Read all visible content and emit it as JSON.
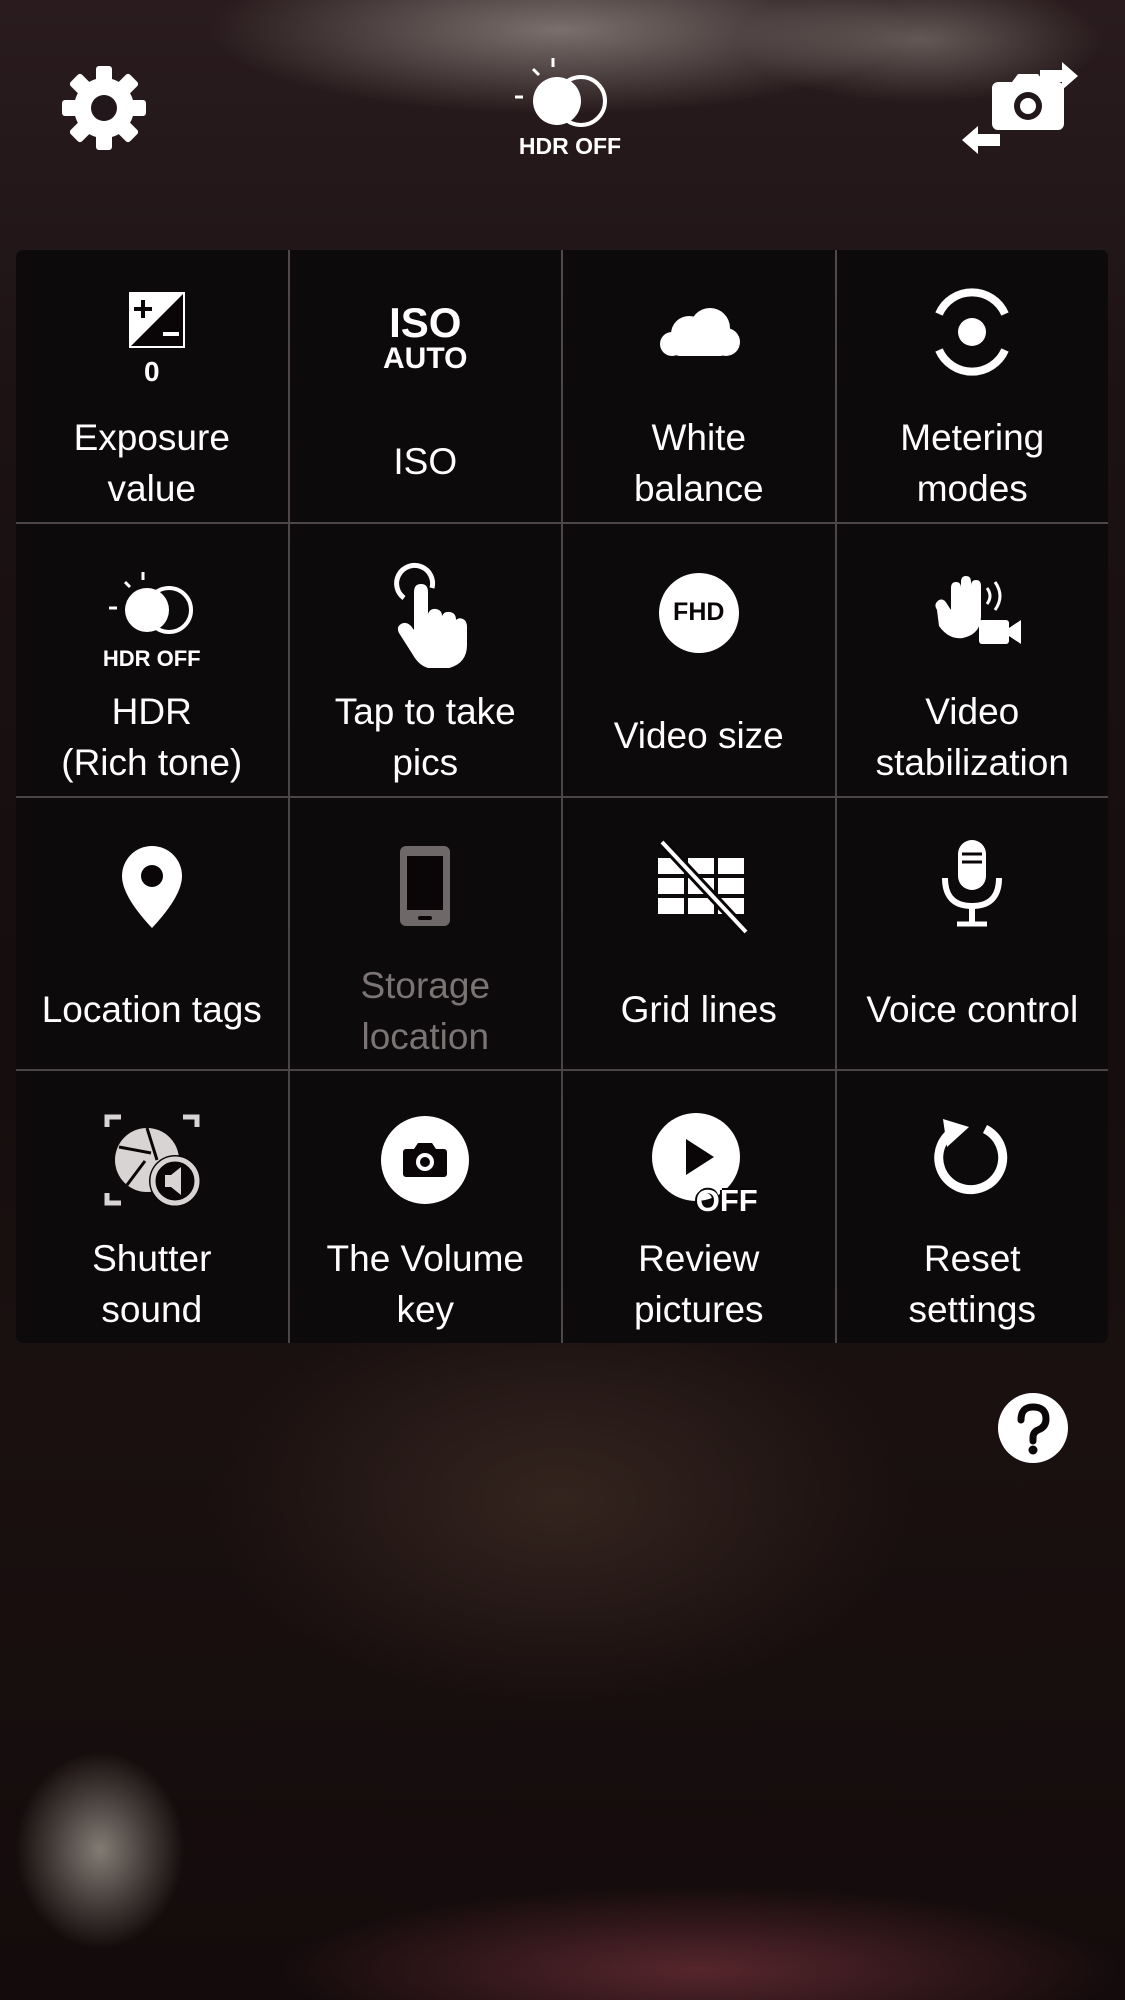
{
  "topbar": {
    "settings_icon": "gear-icon",
    "hdr_badge": "HDR OFF",
    "switch_icon": "switch-camera-icon"
  },
  "settings": [
    {
      "label": "Exposure\nvalue",
      "icon": "exposure-icon",
      "value": "0"
    },
    {
      "label": "ISO",
      "icon": "iso-icon",
      "icon_text_top": "ISO",
      "icon_text_bottom": "AUTO"
    },
    {
      "label": "White\nbalance",
      "icon": "cloud-icon"
    },
    {
      "label": "Metering\nmodes",
      "icon": "metering-icon"
    },
    {
      "label": "HDR\n(Rich tone)",
      "icon": "hdr-icon",
      "icon_text": "HDR OFF"
    },
    {
      "label": "Tap to take\npics",
      "icon": "tap-icon"
    },
    {
      "label": "Video size",
      "icon": "video-size-icon",
      "icon_text": "FHD"
    },
    {
      "label": "Video\nstabilization",
      "icon": "video-stabilization-icon"
    },
    {
      "label": "Location tags",
      "icon": "location-pin-icon"
    },
    {
      "label": "Storage\nlocation",
      "icon": "phone-storage-icon",
      "disabled": true
    },
    {
      "label": "Grid lines",
      "icon": "grid-lines-icon"
    },
    {
      "label": "Voice control",
      "icon": "microphone-icon"
    },
    {
      "label": "Shutter\nsound",
      "icon": "shutter-sound-icon"
    },
    {
      "label": "The Volume\nkey",
      "icon": "camera-icon"
    },
    {
      "label": "Review\npictures",
      "icon": "review-pictures-icon",
      "icon_text": "OFF"
    },
    {
      "label": "Reset\nsettings",
      "icon": "reset-icon"
    }
  ],
  "help_icon": "help-icon"
}
